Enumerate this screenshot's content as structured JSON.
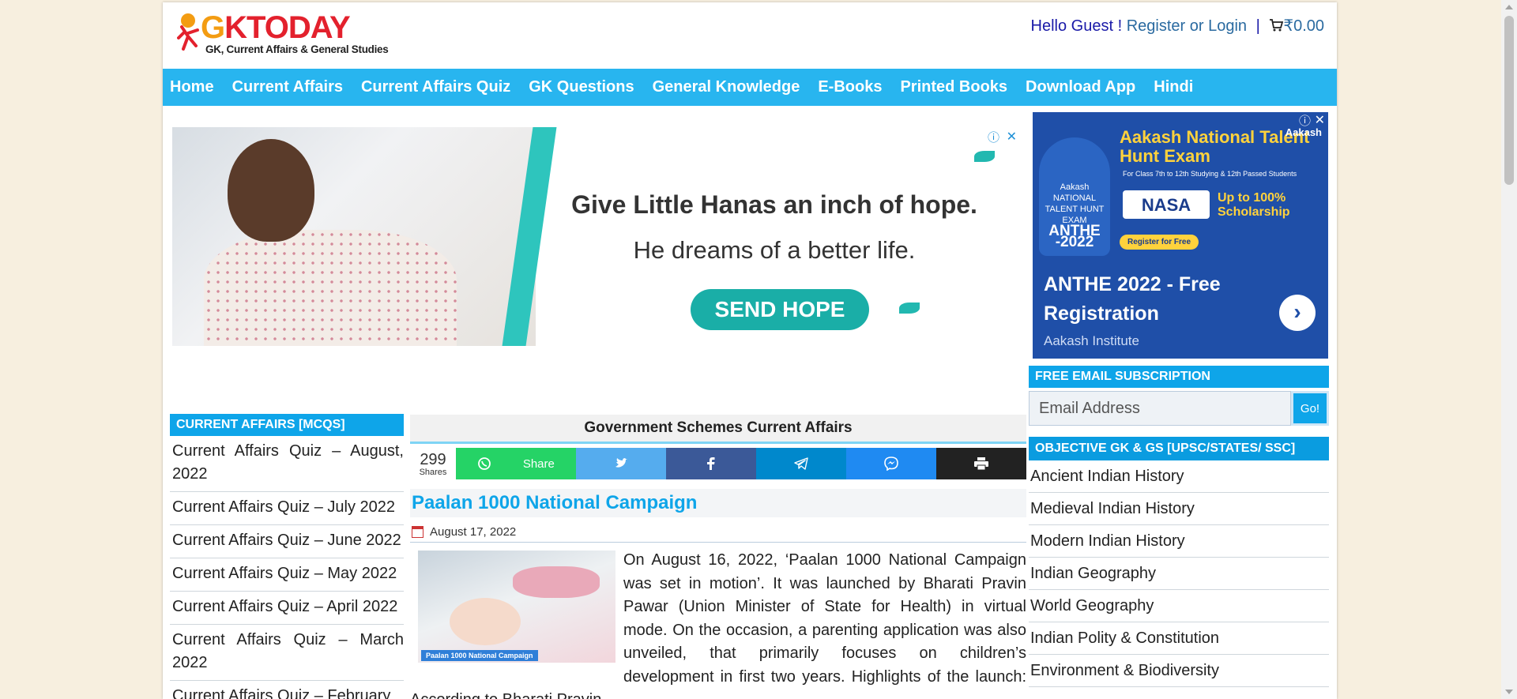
{
  "logo": {
    "brand_first": "G",
    "brand_rest": "KTODAY",
    "tagline": "GK, Current Affairs & General Studies",
    "colors": {
      "orange": "#f39c12",
      "red": "#e3212d"
    }
  },
  "header": {
    "greeting": "Hello Guest !",
    "auth_link": "Register or Login",
    "separator": "|",
    "cart_icon": "cart-icon",
    "cart_total": "₹0.00"
  },
  "nav": {
    "items": [
      "Home",
      "Current Affairs",
      "Current Affairs Quiz",
      "GK Questions",
      "General Knowledge",
      "E-Books",
      "Printed Books",
      "Download App",
      "Hindi"
    ],
    "color": "#28b5ef"
  },
  "ad_banner": {
    "headline": "Give Little Hanas an inch of hope.",
    "subline": "He dreams of a better life.",
    "button": "SEND HOPE",
    "close": "✕",
    "info": "ⓘ"
  },
  "ad_side": {
    "headline": "Aakash National Talent Hunt Exam",
    "subtext": "For Class 7th to 12th Studying & 12th Passed Students",
    "badge_top": "Aakash NATIONAL TALENT HUNT EXAM",
    "badge_big": "ANTHE -2022",
    "nasa": "NASA",
    "scholarship": "Up to 100% Scholarship",
    "register": "Register for Free",
    "brand": "Aakash",
    "title": "ANTHE 2022 - Free Registration",
    "advertiser": "Aakash Institute",
    "arrow": "›",
    "close": "✕",
    "info": "ⓘ"
  },
  "left_sidebar": {
    "heading": "CURRENT AFFAIRS [MCQS]",
    "items": [
      "Current Affairs Quiz – August, 2022",
      "Current Affairs Quiz – July 2022",
      "Current Affairs Quiz – June 2022",
      "Current Affairs Quiz – May 2022",
      "Current Affairs Quiz – April 2022",
      "Current Affairs Quiz – March 2022",
      "Current Affairs Quiz – February"
    ]
  },
  "center": {
    "category": "Government Schemes Current Affairs",
    "share": {
      "count": "299",
      "count_label": "Shares",
      "whatsapp_label": "Share",
      "whatsapp_icon": "whatsapp-icon",
      "twitter_icon": "twitter-icon",
      "facebook_icon": "facebook-icon",
      "telegram_icon": "telegram-icon",
      "messenger_icon": "messenger-icon",
      "print_icon": "print-icon"
    },
    "post": {
      "title": "Paalan 1000 National Campaign",
      "date": "August 17, 2022",
      "thumb_caption": "Paalan 1000 National Campaign",
      "excerpt": "On August 16, 2022, ‘Paalan 1000 National Campaign was set in motion’. It was launched by Bharati Pravin Pawar (Union Minister of State for Health) in virtual mode. On the occasion, a parenting application was also unveiled, that primarily focuses on children’s development in first two years. Highlights of the launch: According to Bharati Pravin .."
    }
  },
  "right_sidebar": {
    "subscription_heading": "FREE EMAIL SUBSCRIPTION",
    "email_placeholder": "Email Address",
    "go_button": "Go!",
    "objective_heading": "OBJECTIVE GK & GS [UPSC/STATES/ SSC]",
    "items": [
      "Ancient Indian History",
      "Medieval Indian History",
      "Modern Indian History",
      "Indian Geography",
      "World Geography",
      "Indian Polity & Constitution",
      "Environment & Biodiversity"
    ]
  }
}
